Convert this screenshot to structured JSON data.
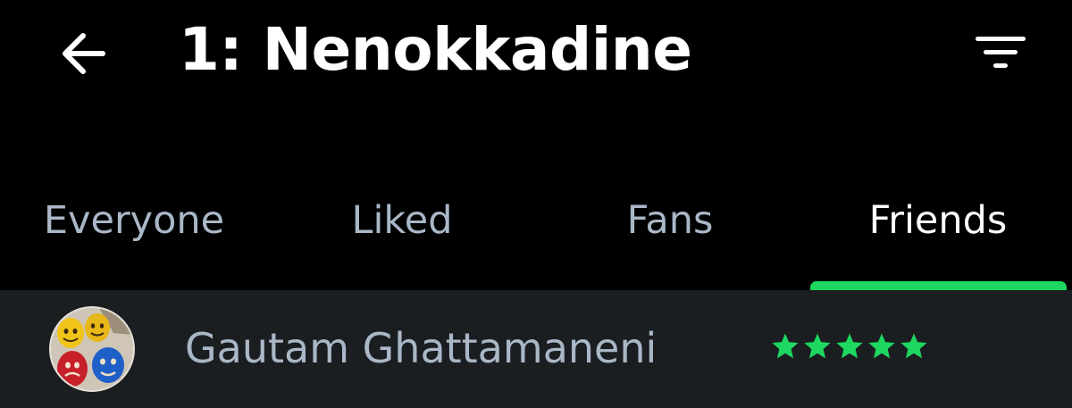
{
  "header": {
    "title": "1: Nenokkadine",
    "back_icon": "back-arrow-icon",
    "filter_icon": "filter-icon"
  },
  "tabs": [
    {
      "label": "Everyone",
      "active": false
    },
    {
      "label": "Liked",
      "active": false
    },
    {
      "label": "Fans",
      "active": false
    },
    {
      "label": "Friends",
      "active": true
    }
  ],
  "list": {
    "items": [
      {
        "name": "Gautam Ghattamaneni",
        "rating": 5,
        "rating_max": 5,
        "avatar_icon": "avatar-image"
      }
    ]
  },
  "colors": {
    "background": "#000000",
    "list_background": "#1b1e21",
    "accent": "#1ed760",
    "text_primary": "#ffffff",
    "text_secondary": "#a9b7c7"
  }
}
